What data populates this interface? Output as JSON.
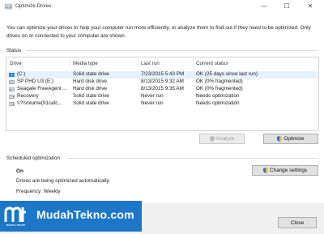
{
  "window": {
    "title": "Optimize Drives",
    "minimize_glyph": "—",
    "maximize_glyph": "☐",
    "close_glyph": "✕"
  },
  "intro_text": "You can optimize your drives to help your computer run more efficiently, or analyze them to find out if they need to be optimized. Only drives on or connected to your computer are shown.",
  "status": {
    "label": "Status",
    "columns": [
      "Drive",
      "Media type",
      "Last run",
      "Current status"
    ],
    "rows": [
      {
        "drive": "(C:)",
        "media": "Solid state drive",
        "last_run": "7/23/2015 5:43 PM",
        "status": "OK (25 days since last run)",
        "icon": "windows-drive-icon",
        "selected": true
      },
      {
        "drive": "SP PHD U3 (E:)",
        "media": "Hard disk drive",
        "last_run": "8/13/2015 9:32 AM",
        "status": "OK (0% fragmented)",
        "icon": "usb-drive-icon",
        "selected": false
      },
      {
        "drive": "Seagate FreeAgent ...",
        "media": "Hard disk drive",
        "last_run": "8/13/2015 9:35 AM",
        "status": "OK (0% fragmented)",
        "icon": "usb-drive-icon",
        "selected": false
      },
      {
        "drive": "Recovery",
        "media": "Solid state drive",
        "last_run": "Never run",
        "status": "Needs optimization",
        "icon": "drive-icon",
        "selected": false
      },
      {
        "drive": "\\\\?\\Volume{91cafc...",
        "media": "Solid state drive",
        "last_run": "Never run",
        "status": "Needs optimization",
        "icon": "drive-icon",
        "selected": false
      }
    ]
  },
  "buttons": {
    "analyze": "Analyze",
    "optimize": "Optimize",
    "change_settings": "Change settings",
    "close": "Close"
  },
  "scheduled": {
    "label": "Scheduled optimization",
    "state": "On",
    "description": "Drives are being optimized automatically.",
    "frequency": "Frequency: Weekly"
  },
  "watermark": {
    "logo_text": "MUDAH TEKNO",
    "site": "MudahTekno.com"
  },
  "colors": {
    "selection": "#e5f1fb",
    "watermark_blue": "#1c77c8",
    "windows_blue": "#0078d7"
  }
}
